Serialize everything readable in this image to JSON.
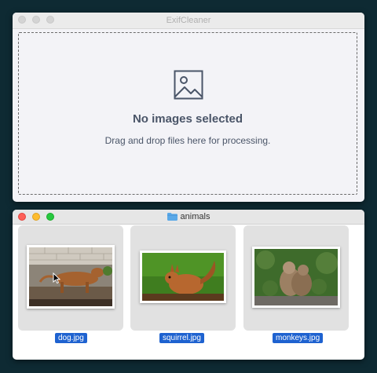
{
  "exif_window": {
    "title": "ExifCleaner",
    "dropzone": {
      "icon": "image-placeholder-icon",
      "heading": "No images selected",
      "subtext": "Drag and drop files here for processing."
    }
  },
  "finder_window": {
    "title": "animals",
    "title_icon": "folder-icon",
    "files": [
      {
        "name": "dog.jpg"
      },
      {
        "name": "squirrel.jpg"
      },
      {
        "name": "monkeys.jpg"
      }
    ]
  },
  "colors": {
    "selection": "#1e62d0",
    "close": "#fe5f57",
    "minimize": "#febc2e",
    "zoom": "#28c840",
    "folder": "#5aa9e8"
  }
}
